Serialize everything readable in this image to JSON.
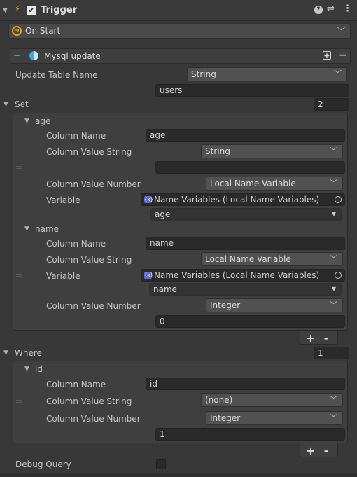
{
  "header": {
    "title": "Trigger",
    "enabled": true
  },
  "event": {
    "label": "On Start"
  },
  "action": {
    "title": "Mysql update",
    "menu_glyph": "="
  },
  "update_table": {
    "label": "Update Table Name",
    "type": "String",
    "value": "users"
  },
  "set": {
    "label": "Set",
    "count": "2",
    "items": [
      {
        "name": "age",
        "column_name_label": "Column Name",
        "column_name": "age",
        "value_string_label": "Column Value String",
        "value_string_type": "String",
        "value_string": "",
        "value_number_label": "Column Value Number",
        "value_number_type": "Local Name Variable",
        "variable_label": "Variable",
        "variable_source": "Name Variables (Local Name Variables)",
        "variable_name": "age"
      },
      {
        "name": "name",
        "column_name_label": "Column Name",
        "column_name": "name",
        "value_string_label": "Column Value String",
        "value_string_type": "Local Name Variable",
        "variable_label": "Variable",
        "variable_source": "Name Variables (Local Name Variables)",
        "variable_name": "name",
        "value_number_label": "Column Value Number",
        "value_number_type": "Integer",
        "value_number": "0"
      }
    ]
  },
  "where": {
    "label": "Where",
    "count": "1",
    "items": [
      {
        "name": "id",
        "column_name_label": "Column Name",
        "column_name": "id",
        "value_string_label": "Column Value String",
        "value_string_type": "(none)",
        "value_number_label": "Column Value Number",
        "value_number_type": "Integer",
        "value_number": "1"
      }
    ]
  },
  "buttons": {
    "add": "+",
    "remove": "-"
  },
  "debug": {
    "label": "Debug Query",
    "checked": false
  }
}
